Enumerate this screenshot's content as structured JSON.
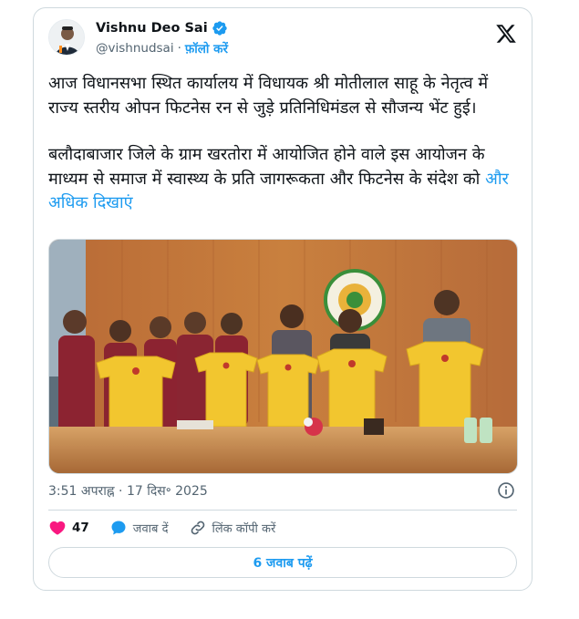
{
  "author": {
    "display_name": "Vishnu Deo Sai",
    "handle": "@vishnudsai",
    "separator": "·",
    "follow_label": "फ़ॉलो करें"
  },
  "tweet": {
    "paragraph1": "आज विधानसभा स्थित कार्यालय में विधायक श्री मोतीलाल साहू के नेतृत्व में राज्य स्तरीय ओपन फिटनेस रन से जुड़े प्रतिनिधिमंडल से सौजन्य भेंट हुई।",
    "paragraph2": "बलौदाबाजार जिले के ग्राम खरतोरा में आयोजित होने वाले इस आयोजन के माध्यम से समाज में स्वास्थ्य के प्रति जागरूकता और फिटनेस के संदेश को",
    "show_more": "और अधिक दिखाएं"
  },
  "timestamp": "3:51 अपराह्न · 17 दिस॰ 2025",
  "actions": {
    "likes": "47",
    "reply_label": "जवाब दें",
    "copy_link_label": "लिंक कॉपी करें"
  },
  "read_replies": "6 जवाब पढ़ें",
  "colors": {
    "accent": "#1d9bf0",
    "like": "#f91880",
    "text": "#0f1419",
    "muted": "#536471",
    "border": "#cfd9de"
  }
}
